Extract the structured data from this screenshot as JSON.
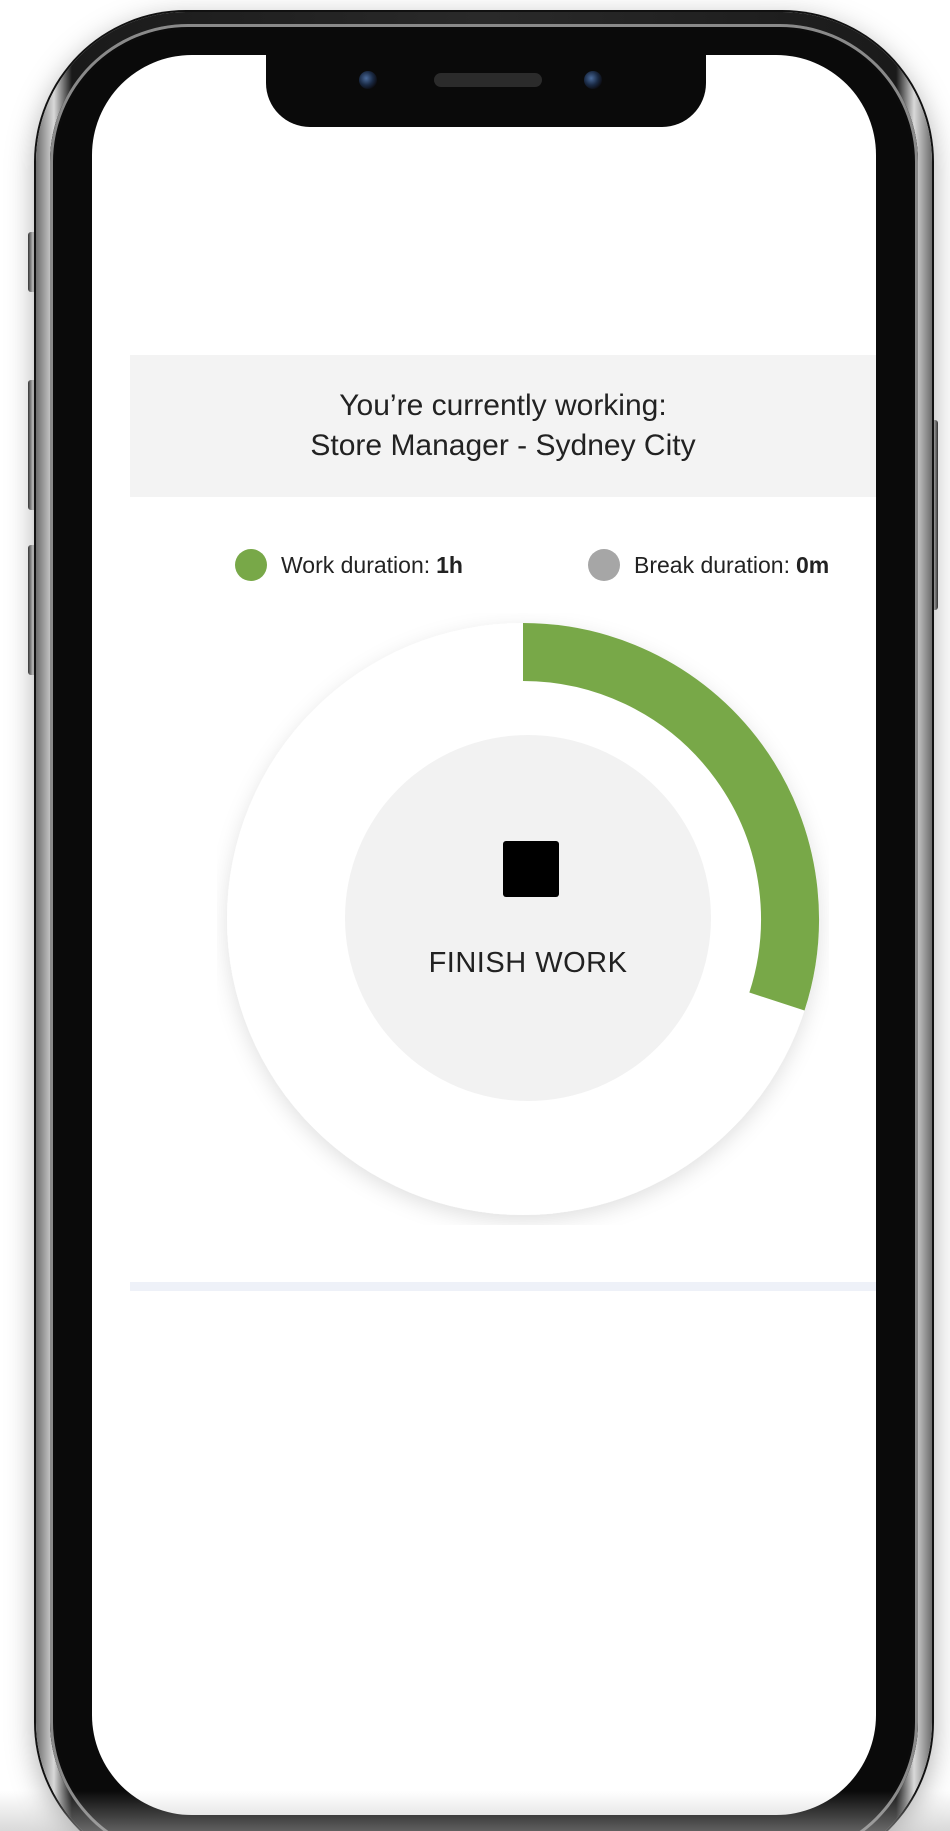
{
  "status": {
    "heading": "You’re currently working:",
    "position": "Store Manager - Sydney City"
  },
  "legend": {
    "work": {
      "label": "Work duration:",
      "value": "1h",
      "color": "#78a848"
    },
    "break": {
      "label": "Break duration:",
      "value": "0m",
      "color": "#a6a6a6"
    }
  },
  "timer": {
    "work_progress_fraction": 0.3,
    "track_color": "#ffffff",
    "progress_color": "#78a848",
    "action_label": "FINISH WORK",
    "action_icon": "stop-icon"
  },
  "colors": {
    "banner_bg": "#f3f3f3",
    "button_bg": "#f2f2f2",
    "divider": "#eef1f8"
  }
}
